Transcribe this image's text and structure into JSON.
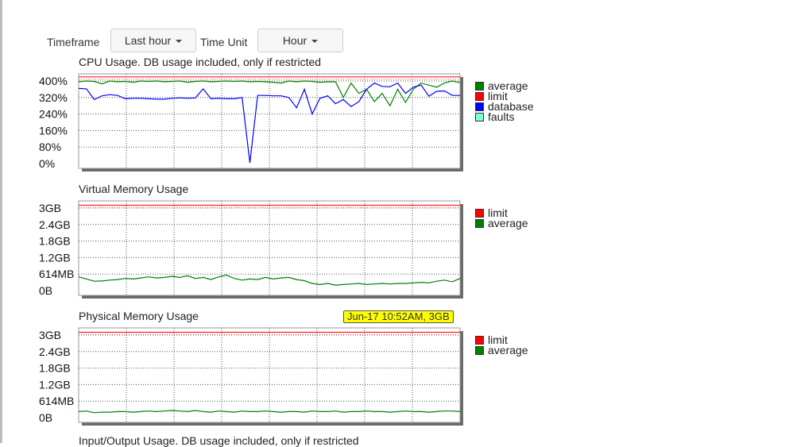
{
  "toolbar": {
    "timeframe_label": "Timeframe",
    "timeframe_value": "Last hour",
    "timeunit_label": "Time Unit",
    "timeunit_value": "Hour"
  },
  "charts": {
    "cpu": {
      "title": "CPU Usage. DB usage included, only if restricted",
      "ticks": [
        "400%",
        "320%",
        "240%",
        "160%",
        "80%",
        "0%"
      ],
      "legend": [
        {
          "label": "average",
          "color": "#008000"
        },
        {
          "label": "limit",
          "color": "#ff0000"
        },
        {
          "label": "database",
          "color": "#0000ff"
        },
        {
          "label": "faults",
          "color": "#7fffd4"
        }
      ]
    },
    "virtual": {
      "title": "Virtual Memory Usage",
      "ticks": [
        "3GB",
        "2.4GB",
        "1.8GB",
        "1.2GB",
        "614MB",
        "0B"
      ],
      "legend": [
        {
          "label": "limit",
          "color": "#ff0000"
        },
        {
          "label": "average",
          "color": "#008000"
        }
      ]
    },
    "physical": {
      "title": "Physical Memory Usage",
      "tooltip": "Jun-17 10:52AM, 3GB",
      "ticks": [
        "3GB",
        "2.4GB",
        "1.8GB",
        "1.2GB",
        "614MB",
        "0B"
      ],
      "legend": [
        {
          "label": "limit",
          "color": "#ff0000"
        },
        {
          "label": "average",
          "color": "#008000"
        }
      ]
    },
    "io": {
      "title": "Input/Output Usage. DB usage included, only if restricted"
    }
  },
  "chart_data": [
    {
      "type": "line",
      "title": "CPU Usage. DB usage included, only if restricted",
      "ylim": [
        0,
        400
      ],
      "yticks": [
        "400%",
        "320%",
        "240%",
        "160%",
        "80%",
        "0%"
      ],
      "series": [
        {
          "name": "limit",
          "values": [
            420,
            420,
            420,
            420,
            420,
            420,
            420,
            420,
            420,
            420,
            420,
            420,
            420,
            420,
            420,
            420,
            420,
            420,
            420,
            420,
            420,
            420,
            420,
            420,
            420,
            420,
            420,
            420,
            420,
            420,
            420,
            420,
            420,
            420,
            420,
            420,
            420,
            420,
            420,
            420,
            420,
            420,
            420,
            420,
            420,
            420,
            420,
            420,
            420,
            420
          ]
        },
        {
          "name": "average",
          "values": [
            396,
            400,
            398,
            386,
            400,
            396,
            398,
            394,
            400,
            398,
            400,
            396,
            398,
            400,
            394,
            398,
            400,
            396,
            398,
            400,
            398,
            400,
            396,
            398,
            396,
            394,
            390,
            400,
            396,
            400,
            398,
            394,
            396,
            396,
            320,
            390,
            340,
            360,
            300,
            340,
            280,
            360,
            296,
            360,
            390,
            380,
            370,
            390,
            400,
            392
          ]
        },
        {
          "name": "database",
          "values": [
            364,
            362,
            310,
            328,
            334,
            330,
            314,
            316,
            316,
            314,
            312,
            312,
            316,
            318,
            316,
            318,
            362,
            314,
            316,
            314,
            314,
            320,
            4,
            330,
            330,
            328,
            328,
            320,
            270,
            360,
            240,
            316,
            328,
            290,
            310,
            276,
            300,
            360,
            390,
            374,
            372,
            390,
            340,
            370,
            380,
            326,
            350,
            352,
            330,
            330
          ]
        }
      ]
    },
    {
      "type": "line",
      "title": "Virtual Memory Usage",
      "yticks": [
        "3GB",
        "2.4GB",
        "1.8GB",
        "1.2GB",
        "614MB",
        "0B"
      ],
      "series": [
        {
          "name": "limit",
          "values": [
            3.1,
            3.1,
            3.1,
            3.1,
            3.1,
            3.1,
            3.1,
            3.1,
            3.1,
            3.1,
            3.1,
            3.1,
            3.1,
            3.1,
            3.1,
            3.1,
            3.1,
            3.1,
            3.1,
            3.1,
            3.1,
            3.1,
            3.1,
            3.1,
            3.1,
            3.1,
            3.1,
            3.1,
            3.1,
            3.1,
            3.1,
            3.1,
            3.1,
            3.1,
            3.1,
            3.1,
            3.1,
            3.1,
            3.1,
            3.1,
            3.1,
            3.1,
            3.1,
            3.1,
            3.1,
            3.1,
            3.1,
            3.1,
            3.1,
            3.1
          ]
        },
        {
          "name": "average",
          "values": [
            0.5,
            0.42,
            0.34,
            0.35,
            0.38,
            0.4,
            0.44,
            0.42,
            0.46,
            0.5,
            0.46,
            0.48,
            0.52,
            0.48,
            0.54,
            0.44,
            0.48,
            0.4,
            0.5,
            0.56,
            0.44,
            0.38,
            0.42,
            0.4,
            0.48,
            0.42,
            0.46,
            0.48,
            0.4,
            0.36,
            0.26,
            0.22,
            0.26,
            0.2,
            0.22,
            0.24,
            0.26,
            0.22,
            0.24,
            0.26,
            0.24,
            0.26,
            0.26,
            0.28,
            0.3,
            0.28,
            0.34,
            0.38,
            0.32,
            0.44
          ]
        }
      ]
    },
    {
      "type": "line",
      "title": "Physical Memory Usage",
      "yticks": [
        "3GB",
        "2.4GB",
        "1.8GB",
        "1.2GB",
        "614MB",
        "0B"
      ],
      "series": [
        {
          "name": "limit",
          "values": [
            3.1,
            3.1,
            3.1,
            3.1,
            3.1,
            3.1,
            3.1,
            3.1,
            3.1,
            3.1,
            3.1,
            3.1,
            3.1,
            3.1,
            3.1,
            3.1,
            3.1,
            3.1,
            3.1,
            3.1,
            3.1,
            3.1,
            3.1,
            3.1,
            3.1,
            3.1,
            3.1,
            3.1,
            3.1,
            3.1,
            3.1,
            3.1,
            3.1,
            3.1,
            3.1,
            3.1,
            3.1,
            3.1,
            3.1,
            3.1,
            3.1,
            3.1,
            3.1,
            3.1,
            3.1,
            3.1,
            3.1,
            3.1,
            3.1,
            3.1
          ]
        },
        {
          "name": "average",
          "values": [
            0.22,
            0.24,
            0.18,
            0.2,
            0.2,
            0.22,
            0.22,
            0.2,
            0.22,
            0.24,
            0.22,
            0.24,
            0.26,
            0.24,
            0.22,
            0.26,
            0.22,
            0.2,
            0.24,
            0.22,
            0.2,
            0.24,
            0.22,
            0.22,
            0.24,
            0.22,
            0.2,
            0.22,
            0.22,
            0.2,
            0.24,
            0.22,
            0.22,
            0.24,
            0.2,
            0.22,
            0.22,
            0.24,
            0.22,
            0.22,
            0.2,
            0.22,
            0.24,
            0.22,
            0.22,
            0.2,
            0.22,
            0.24,
            0.24,
            0.22
          ]
        }
      ]
    }
  ]
}
